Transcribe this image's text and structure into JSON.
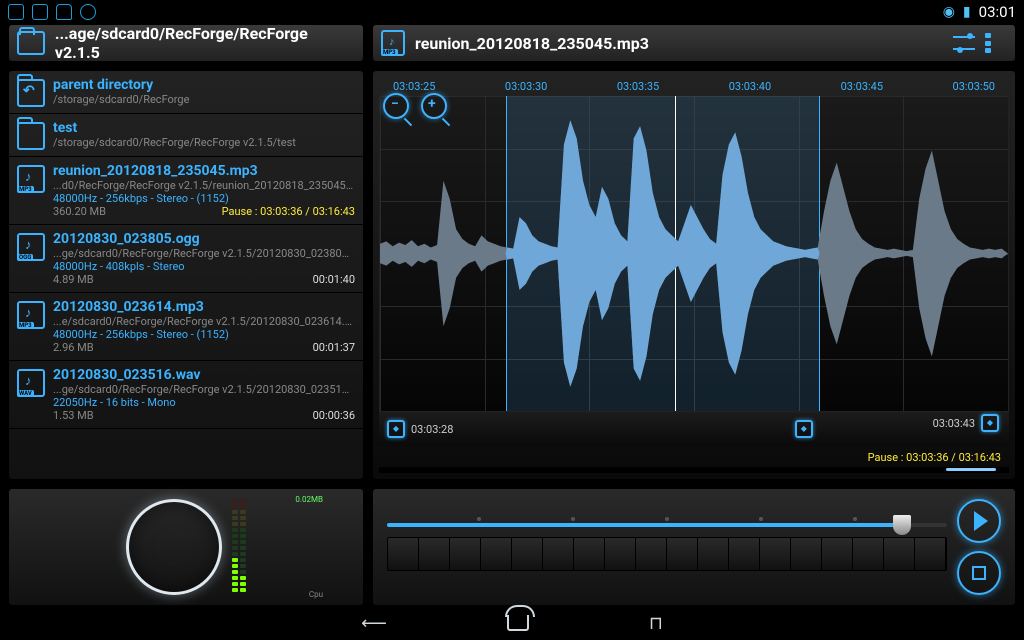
{
  "status": {
    "clock": "03:01"
  },
  "left": {
    "path": "...age/sdcard0/RecForge/RecForge v2.1.5",
    "items": [
      {
        "kind": "updir",
        "title": "parent directory",
        "path": "/storage/sdcard0/RecForge"
      },
      {
        "kind": "folder",
        "title": "test",
        "path": "/storage/sdcard0/RecForge/RecForge v2.1.5/test"
      },
      {
        "kind": "file",
        "ext": "MP3",
        "title": "reunion_20120818_235045.mp3",
        "path": "...d0/RecForge/RecForge v2.1.5/reunion_20120818_235045.mp3",
        "fmt": "48000Hz - 256kbps - Stereo - (1152)",
        "size": "360.20 MB",
        "pause": "Pause : 03:03:36 / 03:16:43"
      },
      {
        "kind": "file",
        "ext": "OGG",
        "title": "20120830_023805.ogg",
        "path": "...ge/sdcard0/RecForge/RecForge v2.1.5/20120830_023805.ogg",
        "fmt": "48000Hz - 408kpls - Stereo",
        "size": "4.89 MB",
        "dur": "00:01:40"
      },
      {
        "kind": "file",
        "ext": "MP3",
        "title": "20120830_023614.mp3",
        "path": "...e/sdcard0/RecForge/RecForge v2.1.5/20120830_023614.mp3",
        "fmt": "48000Hz - 256kbps - Stereo - (1152)",
        "size": "2.96 MB",
        "dur": "00:01:37"
      },
      {
        "kind": "file",
        "ext": "WAV",
        "title": "20120830_023516.wav",
        "path": "...ge/sdcard0/RecForge/RecForge v2.1.5/20120830_023516.wav",
        "fmt": "22050Hz - 16 bits - Mono",
        "size": "1.53 MB",
        "dur": "00:00:36"
      }
    ]
  },
  "right": {
    "file_label_ext": "MP3",
    "file_title": "reunion_20120818_235045.mp3",
    "timeaxis": [
      "03:03:25",
      "03:03:30",
      "03:03:35",
      "03:03:40",
      "03:03:45",
      "03:03:50"
    ],
    "marker_left": "03:03:28",
    "marker_right": "03:03:43",
    "pause": "Pause : 03:03:36 / 03:16:43",
    "seek_pct": 92
  },
  "vu": {
    "top": "0.02MB",
    "bot": "Cpu"
  }
}
